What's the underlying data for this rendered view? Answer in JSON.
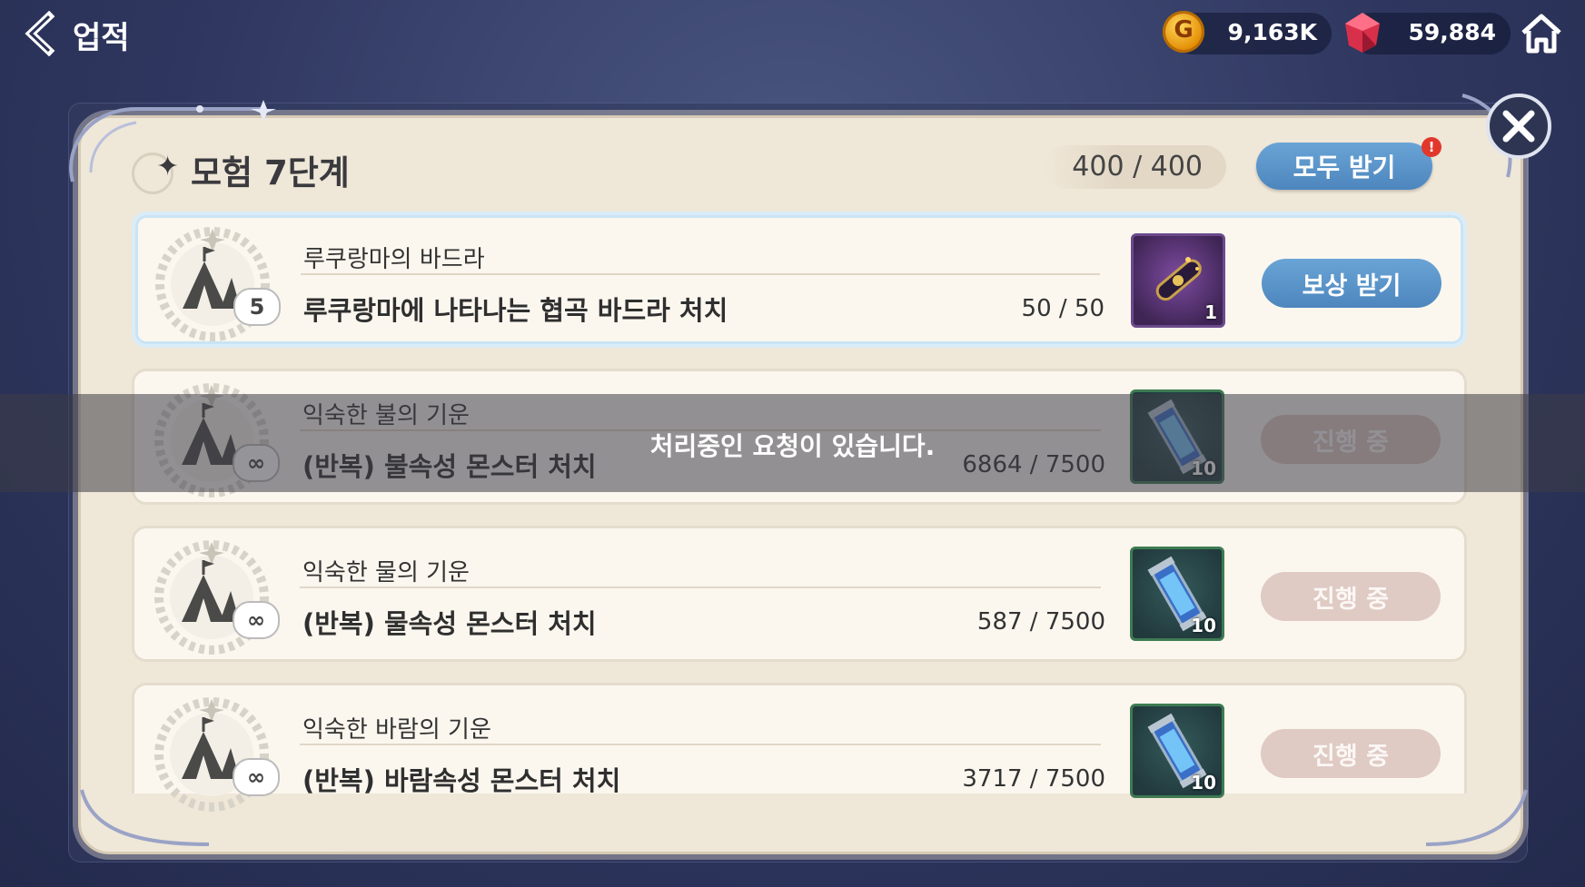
{
  "header": {
    "title": "업적",
    "gold_value": "9,163K",
    "gem_value": "59,884",
    "coin_letter": "G"
  },
  "panel": {
    "stage_title": "모험 7단계",
    "stage_score": "400 / 400",
    "claim_all_label": "모두 받기",
    "notif_mark": "!"
  },
  "rows": [
    {
      "badge": "5",
      "title": "루쿠랑마의 바드라",
      "desc": "루쿠랑마에 나타나는 협곡 바드라 처치",
      "progress": "50 / 50",
      "reward_qty": "1",
      "button": "보상 받기"
    },
    {
      "badge": "∞",
      "title": "익숙한 불의 기운",
      "desc": "(반복) 불속성 몬스터 처치",
      "progress": "6864 / 7500",
      "reward_qty": "10",
      "button": "진행 중"
    },
    {
      "badge": "∞",
      "title": "익숙한 물의 기운",
      "desc": "(반복) 물속성 몬스터 처치",
      "progress": "587 / 7500",
      "reward_qty": "10",
      "button": "진행 중"
    },
    {
      "badge": "∞",
      "title": "익숙한 바람의 기운",
      "desc": "(반복) 바람속성 몬스터 처치",
      "progress": "3717 / 7500",
      "reward_qty": "10",
      "button": "진행 중"
    }
  ],
  "toast": {
    "message": "처리중인 요청이 있습니다."
  },
  "colors": {
    "accent_blue": "#5a94c9",
    "panel_bg": "#efe7d8",
    "in_progress": "#dfcac4"
  }
}
